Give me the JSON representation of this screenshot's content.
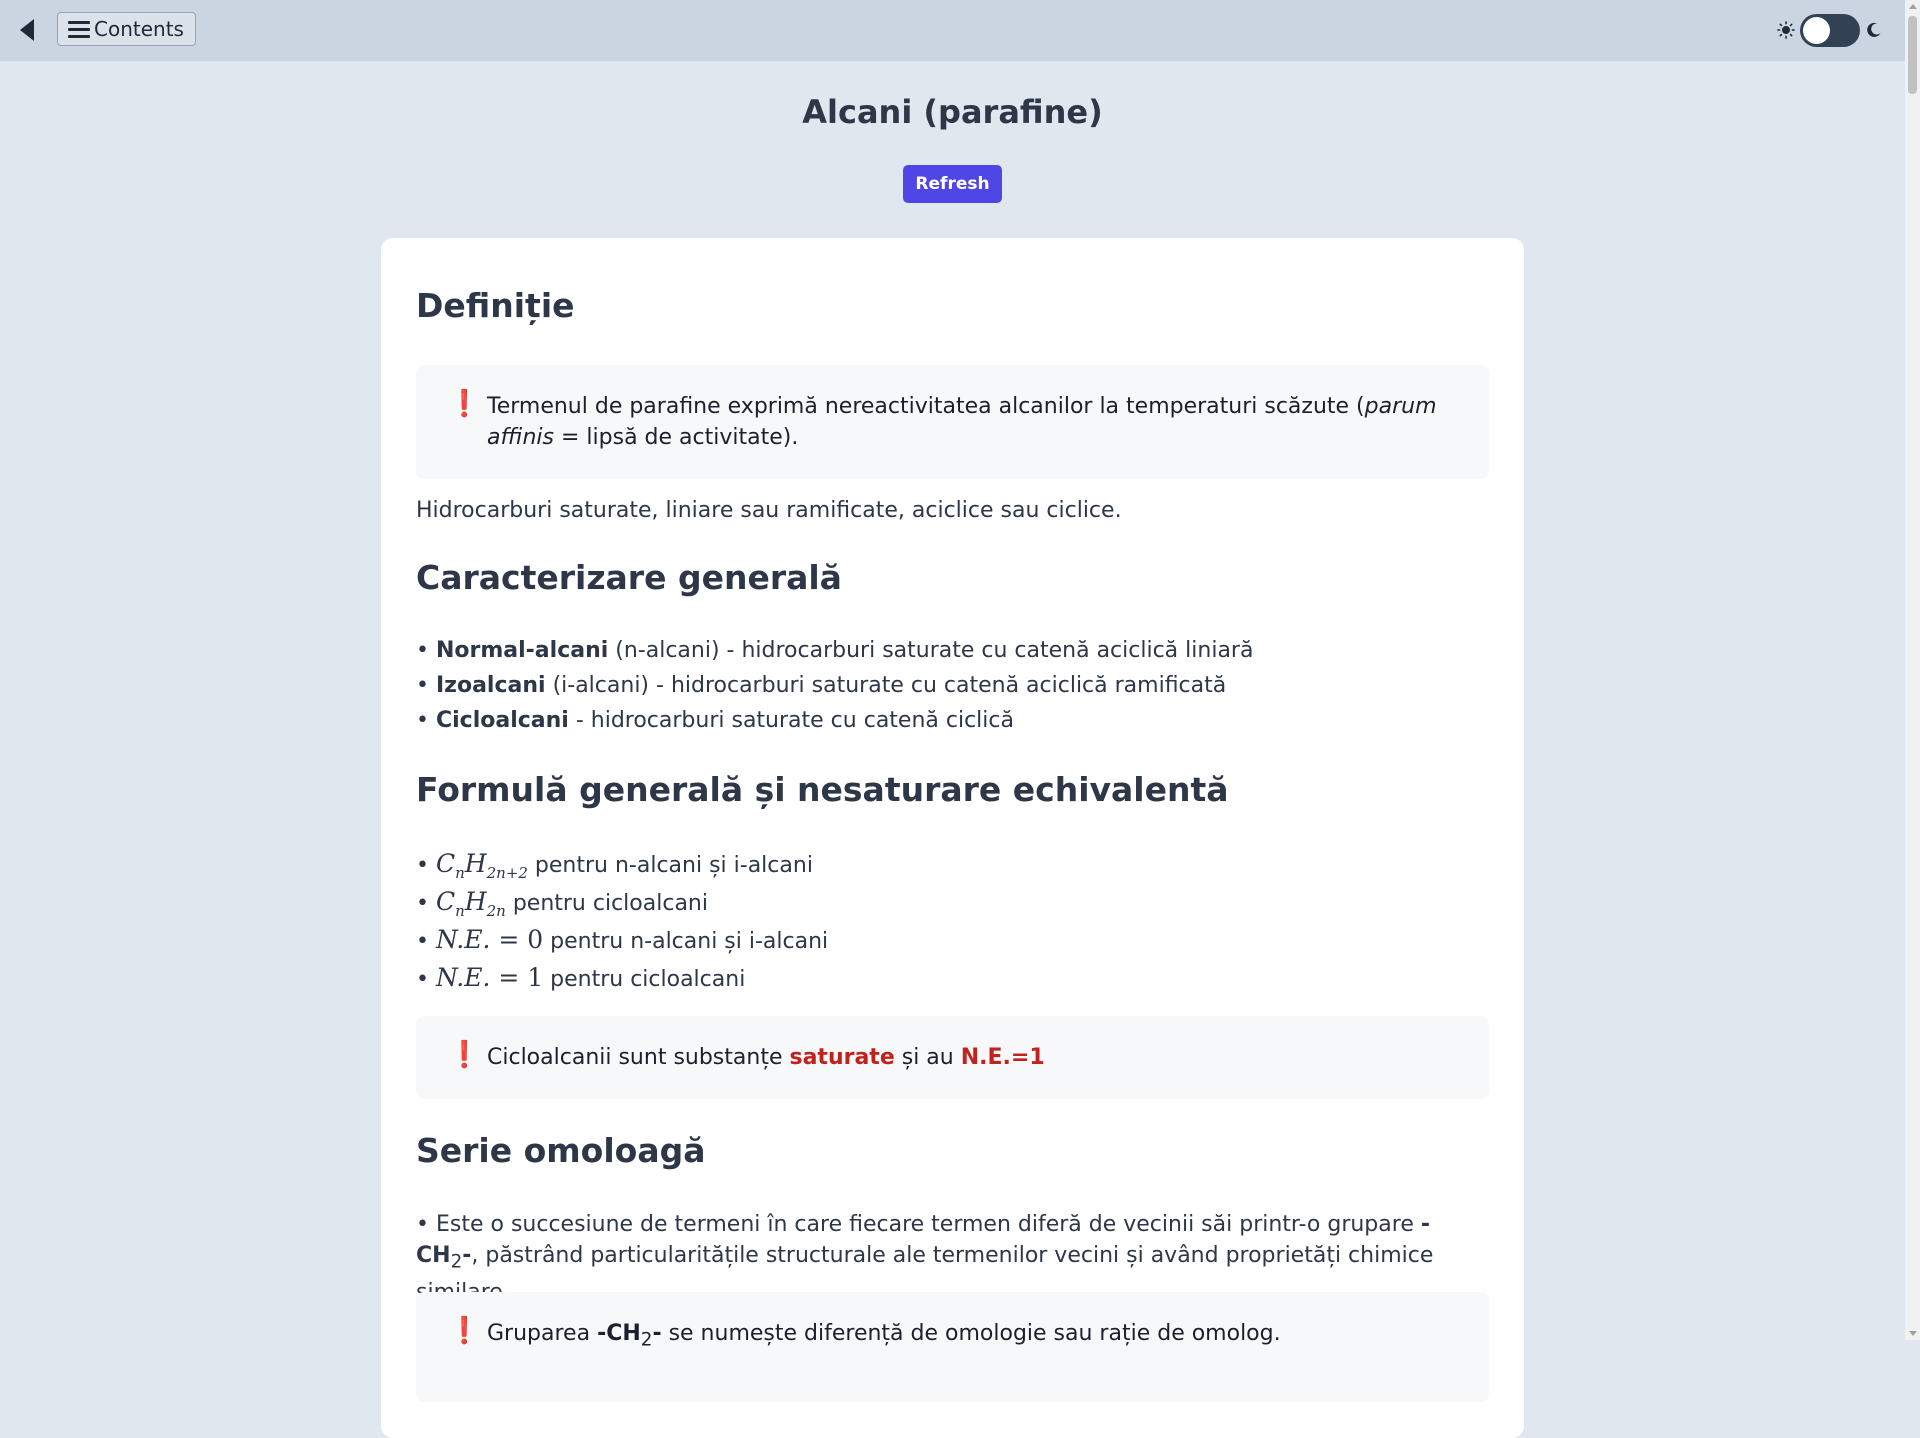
{
  "topbar": {
    "contents_label": "Contents",
    "icons": {
      "back": "back-arrow-icon",
      "menu": "hamburger-icon",
      "light": "sun-icon",
      "dark": "moon-icon"
    }
  },
  "page": {
    "title": "Alcani (parafine)",
    "refresh_label": "Refresh",
    "accent_color": "#4f46e5"
  },
  "sections": {
    "definitie": {
      "heading": "Definiție",
      "note_bang": "❗",
      "note_text_a": "Termenul de parafine exprimă nereactivitatea alcanilor la temperaturi scăzute (",
      "note_text_italic": "parum affinis",
      "note_text_b": " = lipsă de activitate).",
      "paragraph": "Hidrocarburi saturate, liniare sau ramificate, aciclice sau ciclice."
    },
    "caracterizare": {
      "heading": "Caracterizare generală",
      "items": [
        {
          "bullet": "• ",
          "bold": "Normal-alcani",
          "rest": " (n-alcani) - hidrocarburi saturate cu catenă aciclică liniară"
        },
        {
          "bullet": "• ",
          "bold": "Izoalcani",
          "rest": " (i-alcani) - hidrocarburi saturate cu catenă aciclică ramificată"
        },
        {
          "bullet": "• ",
          "bold": "Cicloalcani",
          "rest": " - hidrocarburi saturate cu catenă ciclică"
        }
      ]
    },
    "formula": {
      "heading": "Formulă generală și nesaturare echivalentă",
      "items": [
        {
          "bullet": "• ",
          "m1": "C",
          "s1": "n",
          "m2": "H",
          "s2": "2n+2",
          "rest": " pentru n-alcani și i-alcani"
        },
        {
          "bullet": "• ",
          "m1": "C",
          "s1": "n",
          "m2": "H",
          "s2": "2n",
          "rest": " pentru cicloalcani"
        },
        {
          "bullet": "• ",
          "math": "N.E.",
          "eq": " = 0",
          "rest": " pentru n-alcani și i-alcani"
        },
        {
          "bullet": "• ",
          "math": "N.E.",
          "eq": " = 1",
          "rest": " pentru cicloalcani"
        }
      ],
      "note_bang": "❗",
      "note_a": "Cicloalcanii sunt substanțe ",
      "note_red1": "saturate",
      "note_b": " și au ",
      "note_red2": "N.E.=1"
    },
    "serie": {
      "heading": "Serie omoloagă",
      "para_a": "• Este o succesiune de termeni în care fiecare termen diferă de vecinii săi printr-o grupare ",
      "para_bold": "-CH",
      "para_sub": "2",
      "para_bold2": "-",
      "para_b": ", păstrând particularitățile structurale ale termenilor vecini și având proprietăți chimice similare.",
      "note_bang": "❗",
      "note_a": "Gruparea ",
      "note_bold": "-CH",
      "note_sub": "2",
      "note_bold2": "-",
      "note_b": " se numește diferență de omologie sau rație de omolog."
    }
  }
}
